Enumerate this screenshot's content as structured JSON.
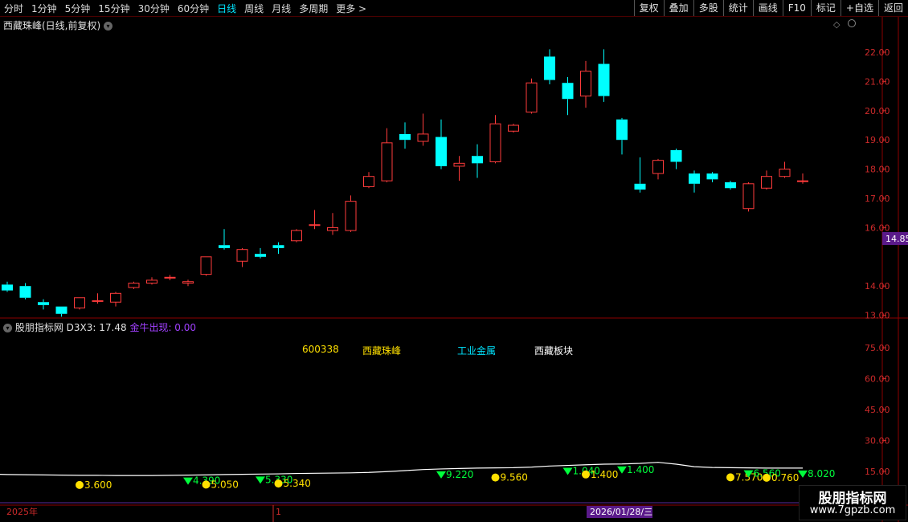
{
  "toolbar": {
    "periods": [
      {
        "label": "分时",
        "active": false
      },
      {
        "label": "1分钟",
        "active": false
      },
      {
        "label": "5分钟",
        "active": false
      },
      {
        "label": "15分钟",
        "active": false
      },
      {
        "label": "30分钟",
        "active": false
      },
      {
        "label": "60分钟",
        "active": false
      },
      {
        "label": "日线",
        "active": true
      },
      {
        "label": "周线",
        "active": false
      },
      {
        "label": "月线",
        "active": false
      },
      {
        "label": "多周期",
        "active": false
      },
      {
        "label": "更多 >",
        "active": false
      }
    ],
    "actions": [
      "复权",
      "叠加",
      "多股",
      "统计",
      "画线",
      "F10",
      "标记",
      "+自选",
      "返回"
    ]
  },
  "main_panel": {
    "title": "西藏珠峰(日线,前复权)",
    "y_ticks": [
      "22.00",
      "21.00",
      "20.00",
      "19.00",
      "18.00",
      "17.00",
      "16.00",
      "14.00",
      "13.00"
    ],
    "price_badge": "14.85"
  },
  "indicator_panel": {
    "name": "股朋指标网",
    "series_label": "D3X3: 17.48",
    "signal_label": "金牛出现: 0.00",
    "info_code": "600338",
    "info_name": "西藏珠峰",
    "info_industry": "工业金属",
    "info_sector": "西藏板块",
    "y_ticks": [
      "75.00",
      "60.00",
      "45.00",
      "30.00",
      "15.00"
    ],
    "marker_labels": [
      "3.600",
      "4.390",
      "5.050",
      "5.330",
      "5.340",
      "9.220",
      "9.560",
      "1.040",
      "1.400",
      "1.400",
      "7.570",
      "6.560",
      "0.760",
      "8.020"
    ]
  },
  "time_axis": {
    "year_label": "2025年",
    "mid_label": "1",
    "cursor_date": "2026/01/28/三"
  },
  "watermark": {
    "line1": "股朋指标网",
    "line2": "www.7gpzb.com"
  },
  "chart_data": {
    "type": "candlestick",
    "colors": {
      "up": "#ff3b3b",
      "down": "#00ffff",
      "line": "#ffffff",
      "buy": "#ffe000",
      "sell": "#00ff3c"
    },
    "y_range": [
      12.6,
      22.4
    ],
    "candles": [
      {
        "o": 14.05,
        "h": 14.15,
        "l": 13.8,
        "c": 13.85
      },
      {
        "o": 14.0,
        "h": 14.1,
        "l": 13.55,
        "c": 13.6
      },
      {
        "o": 13.45,
        "h": 13.55,
        "l": 13.2,
        "c": 13.35
      },
      {
        "o": 13.3,
        "h": 13.3,
        "l": 12.95,
        "c": 13.05
      },
      {
        "o": 13.25,
        "h": 13.6,
        "l": 13.2,
        "c": 13.6
      },
      {
        "o": 13.5,
        "h": 13.75,
        "l": 13.4,
        "c": 13.5
      },
      {
        "o": 13.45,
        "h": 13.8,
        "l": 13.3,
        "c": 13.75
      },
      {
        "o": 13.95,
        "h": 14.15,
        "l": 13.9,
        "c": 14.1
      },
      {
        "o": 14.1,
        "h": 14.3,
        "l": 14.05,
        "c": 14.2
      },
      {
        "o": 14.3,
        "h": 14.38,
        "l": 14.2,
        "c": 14.3
      },
      {
        "o": 14.1,
        "h": 14.22,
        "l": 14.0,
        "c": 14.15
      },
      {
        "o": 14.4,
        "h": 15.0,
        "l": 14.35,
        "c": 15.0
      },
      {
        "o": 15.4,
        "h": 15.95,
        "l": 15.25,
        "c": 15.3
      },
      {
        "o": 14.85,
        "h": 15.3,
        "l": 14.65,
        "c": 15.25
      },
      {
        "o": 15.1,
        "h": 15.3,
        "l": 14.95,
        "c": 15.0
      },
      {
        "o": 15.4,
        "h": 15.5,
        "l": 15.1,
        "c": 15.3
      },
      {
        "o": 15.55,
        "h": 15.95,
        "l": 15.5,
        "c": 15.9
      },
      {
        "o": 16.1,
        "h": 16.6,
        "l": 15.95,
        "c": 16.1
      },
      {
        "o": 15.9,
        "h": 16.5,
        "l": 15.75,
        "c": 16.0
      },
      {
        "o": 15.9,
        "h": 17.1,
        "l": 15.85,
        "c": 16.9
      },
      {
        "o": 17.4,
        "h": 17.9,
        "l": 17.35,
        "c": 17.75
      },
      {
        "o": 17.6,
        "h": 19.4,
        "l": 17.55,
        "c": 18.9
      },
      {
        "o": 19.2,
        "h": 19.6,
        "l": 18.7,
        "c": 19.0
      },
      {
        "o": 18.95,
        "h": 19.9,
        "l": 18.8,
        "c": 19.2
      },
      {
        "o": 19.1,
        "h": 19.7,
        "l": 18.0,
        "c": 18.1
      },
      {
        "o": 18.1,
        "h": 18.45,
        "l": 17.6,
        "c": 18.2
      },
      {
        "o": 18.45,
        "h": 18.85,
        "l": 17.7,
        "c": 18.2
      },
      {
        "o": 18.25,
        "h": 19.85,
        "l": 18.2,
        "c": 19.55
      },
      {
        "o": 19.3,
        "h": 19.55,
        "l": 19.25,
        "c": 19.5
      },
      {
        "o": 19.95,
        "h": 21.1,
        "l": 19.9,
        "c": 20.95
      },
      {
        "o": 21.85,
        "h": 22.1,
        "l": 20.9,
        "c": 21.05
      },
      {
        "o": 20.95,
        "h": 21.15,
        "l": 19.85,
        "c": 20.4
      },
      {
        "o": 20.5,
        "h": 21.7,
        "l": 20.1,
        "c": 21.35
      },
      {
        "o": 21.6,
        "h": 22.1,
        "l": 20.3,
        "c": 20.5
      },
      {
        "o": 19.7,
        "h": 19.75,
        "l": 18.5,
        "c": 19.0
      },
      {
        "o": 17.5,
        "h": 18.4,
        "l": 17.2,
        "c": 17.3
      },
      {
        "o": 17.85,
        "h": 18.35,
        "l": 17.65,
        "c": 18.3
      },
      {
        "o": 18.65,
        "h": 18.7,
        "l": 18.0,
        "c": 18.25
      },
      {
        "o": 17.85,
        "h": 17.95,
        "l": 17.2,
        "c": 17.5
      },
      {
        "o": 17.85,
        "h": 17.9,
        "l": 17.55,
        "c": 17.65
      },
      {
        "o": 17.55,
        "h": 17.6,
        "l": 17.3,
        "c": 17.35
      },
      {
        "o": 16.65,
        "h": 17.55,
        "l": 16.55,
        "c": 17.5
      },
      {
        "o": 17.35,
        "h": 17.95,
        "l": 17.3,
        "c": 17.75
      },
      {
        "o": 17.75,
        "h": 18.25,
        "l": 17.7,
        "c": 18.0
      },
      {
        "o": 17.6,
        "h": 17.85,
        "l": 17.5,
        "c": 17.6
      }
    ],
    "indicator_y_range": [
      8,
      85
    ],
    "indicator_line": [
      13.5,
      13.4,
      13.3,
      13.2,
      13.1,
      13.1,
      13.0,
      13.0,
      13.0,
      13.1,
      13.2,
      13.3,
      13.5,
      13.6,
      13.7,
      13.8,
      14.0,
      14.1,
      14.2,
      14.3,
      14.5,
      14.9,
      15.4,
      15.9,
      16.2,
      16.4,
      16.6,
      16.7,
      16.8,
      17.1,
      17.6,
      17.9,
      18.2,
      18.5,
      18.6,
      18.9,
      19.4,
      18.5,
      17.3,
      16.9,
      16.8,
      16.7,
      16.6,
      16.6,
      16.6
    ],
    "indicator_markers": [
      {
        "i": 4,
        "type": "buy",
        "label": 0
      },
      {
        "i": 10,
        "type": "sell",
        "label": 1
      },
      {
        "i": 11,
        "type": "buy",
        "label": 2
      },
      {
        "i": 14,
        "type": "sell",
        "label": 3
      },
      {
        "i": 15,
        "type": "buy",
        "label": 4
      },
      {
        "i": 24,
        "type": "sell",
        "label": 5
      },
      {
        "i": 27,
        "type": "buy",
        "label": 6
      },
      {
        "i": 31,
        "type": "sell",
        "label": 7
      },
      {
        "i": 32,
        "type": "buy",
        "label": 8
      },
      {
        "i": 34,
        "type": "sell",
        "label": 9
      },
      {
        "i": 40,
        "type": "buy",
        "label": 10
      },
      {
        "i": 41,
        "type": "sell",
        "label": 11
      },
      {
        "i": 42,
        "type": "buy",
        "label": 12
      },
      {
        "i": 44,
        "type": "sell",
        "label": 13
      }
    ]
  }
}
